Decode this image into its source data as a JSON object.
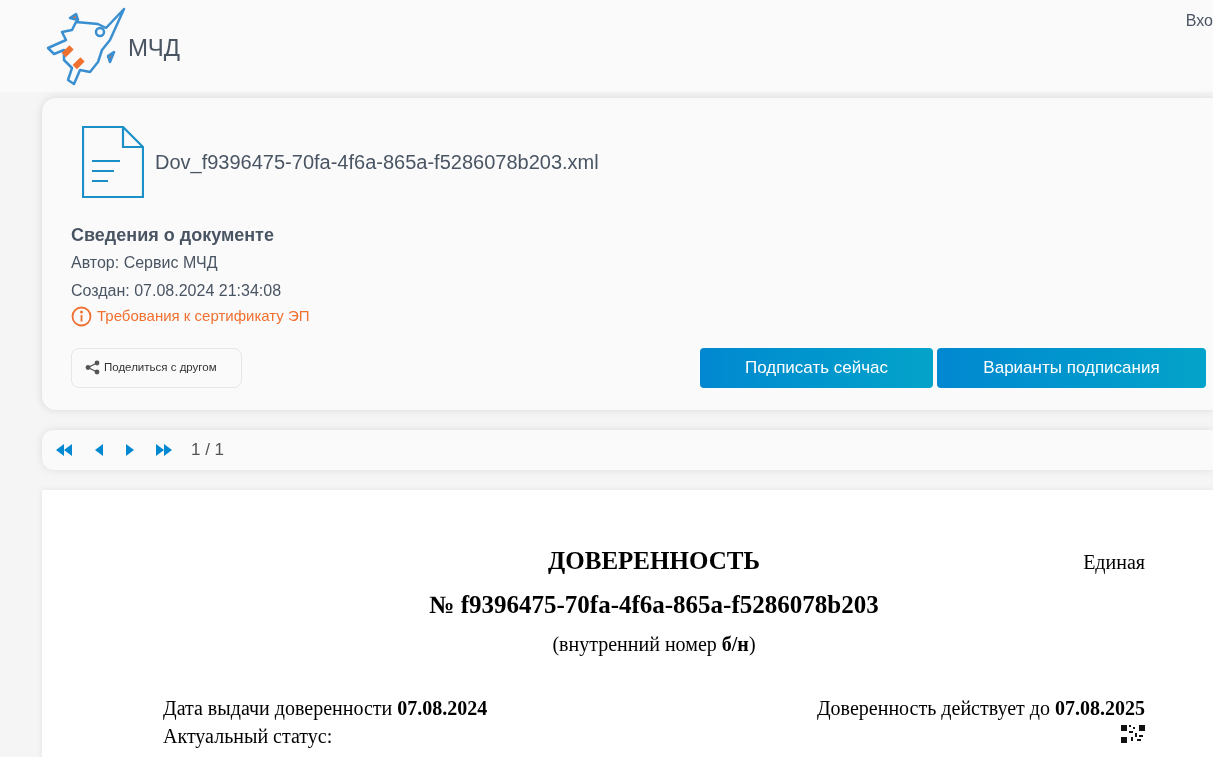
{
  "header": {
    "logo_text": "МЧД",
    "login_link": "Вхо"
  },
  "document_card": {
    "file_name": "Dov_f9396475-70fa-4f6a-865a-f5286078b203.xml",
    "info_title": "Сведения о документе",
    "author": "Автор: Сервис МЧД",
    "created": "Создан: 07.08.2024 21:34:08",
    "certificate_link": "Требования к сертификату ЭП",
    "share_button": "Поделиться с другом",
    "buttons": [
      "Подписать сейчас",
      "Варианты подписания"
    ]
  },
  "pager": {
    "page": "1 / 1"
  },
  "document": {
    "title": "ДОВЕРЕННОСТЬ",
    "corner_text": "Единая",
    "number": "№ f9396475-70fa-4f6a-865a-f5286078b203",
    "internal_number": "(внутренний номер **б/н**)",
    "issue_date": "Дата выдачи доверенности **07.08.2024**",
    "valid_until": "Доверенность действует до **07.08.2025**",
    "status_label": "Актуальный статус:"
  }
}
